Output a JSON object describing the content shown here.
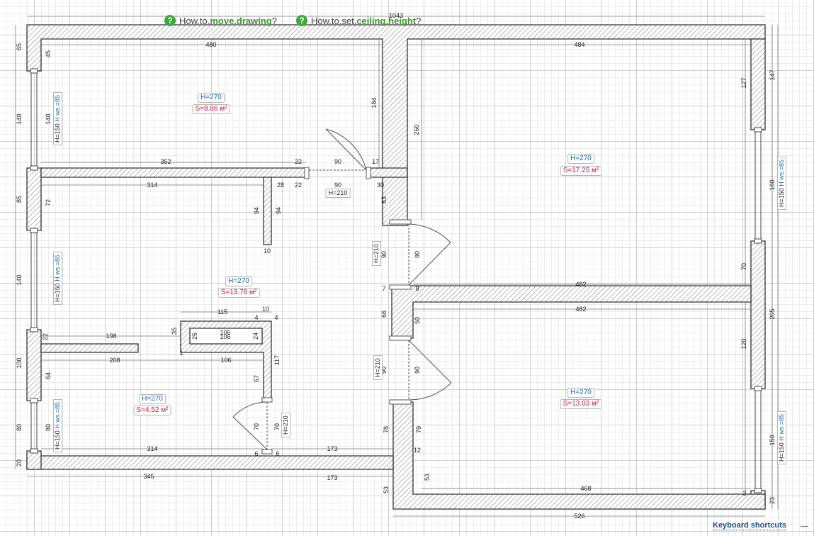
{
  "help": {
    "move_prefix": "How.to.",
    "move_keyword": "move.drawing",
    "move_suffix": "?",
    "ceiling_prefix": "How.to.set.",
    "ceiling_keyword": "ceiling.height",
    "ceiling_suffix": "?"
  },
  "footer": {
    "keyboard_shortcuts": "Keyboard shortcuts"
  },
  "rooms": [
    {
      "height": "H=270",
      "area": "S=8.86 м²"
    },
    {
      "height": "H=270",
      "area": "S=17.25 м²"
    },
    {
      "height": "H=270",
      "area": "S=13.78 м²"
    },
    {
      "height": "H=270",
      "area": "S=4.52 м²"
    },
    {
      "height": "H=270",
      "area": "S=13.03 м²"
    }
  ],
  "windows": [
    {
      "h": "H=150",
      "ws": "H ws.=85"
    },
    {
      "h": "H=150",
      "ws": "H ws.=85"
    },
    {
      "h": "H=150",
      "ws": "H ws.=85"
    },
    {
      "h": "H=150",
      "ws": "H ws.=85"
    },
    {
      "h": "H=150",
      "ws": "H ws.=85"
    }
  ],
  "doors": [
    "H=210",
    "H=210",
    "H=210",
    "H=210"
  ],
  "dimensions": {
    "top_total": "1043",
    "bottom_total": "526",
    "left": [
      "65",
      "140",
      "85",
      "140",
      "100",
      "80",
      "20"
    ],
    "right": [
      "147",
      "160",
      "205",
      "150",
      "23"
    ],
    "items": [
      "480",
      "484",
      "352",
      "22",
      "90",
      "17",
      "314",
      "28",
      "22",
      "90",
      "30",
      "184",
      "260",
      "127",
      "45",
      "140",
      "72",
      "94",
      "94",
      "10",
      "63",
      "90",
      "90",
      "7",
      "8",
      "482",
      "482",
      "70",
      "115",
      "10",
      "4",
      "4",
      "35",
      "25",
      "106",
      "106",
      "24",
      "198",
      "208",
      "106",
      "64",
      "67",
      "117",
      "66",
      "50",
      "90",
      "90",
      "120",
      "80",
      "70",
      "70",
      "6",
      "6",
      "314",
      "173",
      "78",
      "79",
      "12",
      "53",
      "53",
      "173",
      "345",
      "468",
      "3",
      "22",
      "1"
    ]
  }
}
